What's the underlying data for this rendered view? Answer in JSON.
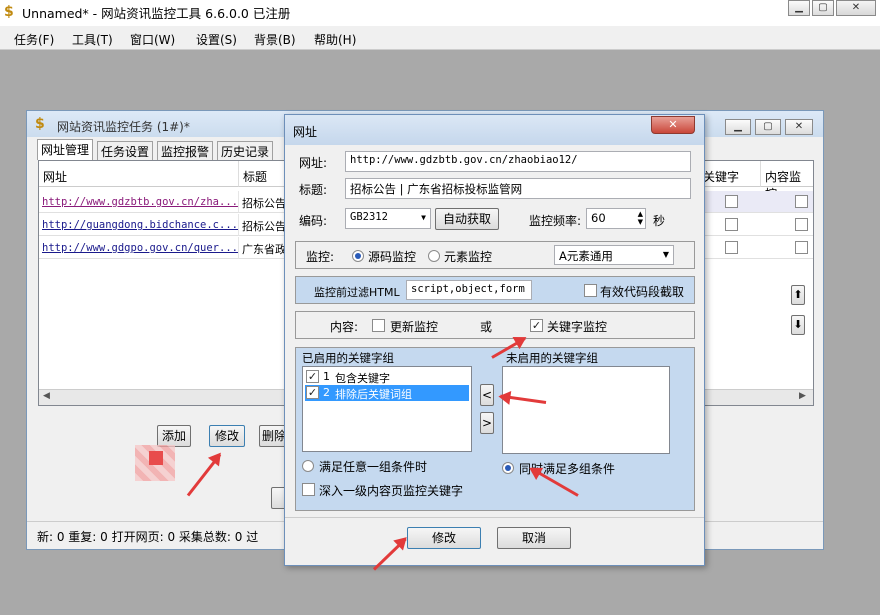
{
  "main_window": {
    "title": "Unnamed* - 网站资讯监控工具 6.6.0.0 已注册",
    "app_icon": "dollar-icon",
    "menus": [
      "任务(F)",
      "工具(T)",
      "窗口(W)",
      "设置(S)",
      "背景(B)",
      "帮助(H)"
    ]
  },
  "task_window": {
    "title": "网站资讯监控任务 (1#)*",
    "tabs": [
      "网址管理",
      "任务设置",
      "监控报警",
      "历史记录"
    ],
    "columns": {
      "url": "网址",
      "title": "标题",
      "keyword": "关键字",
      "content": "内容监控"
    },
    "rows": [
      {
        "url": "http://www.gdzbtb.gov.cn/zha...",
        "title": "招标公告"
      },
      {
        "url": "http://guangdong.bidchance.c...",
        "title": "招标公告"
      },
      {
        "url": "http://www.gdgpo.gov.cn/quer...",
        "title": "广东省政"
      }
    ],
    "buttons": {
      "add": "添加",
      "modify": "修改",
      "delete": "删除"
    },
    "status_bar": "新: 0  重复: 0  打开网页: 0  采集总数: 0  过"
  },
  "dialog": {
    "title": "网址",
    "url_label": "网址:",
    "url_value": "http://www.gdzbtb.gov.cn/zhaobiao12/",
    "title_label": "标题:",
    "title_value": "招标公告 | 广东省招标投标监管网",
    "encoding_label": "编码:",
    "encoding_value": "GB2312",
    "auto_get_button": "自动获取",
    "frequency_label": "监控频率:",
    "frequency_value": "60",
    "frequency_unit": "秒",
    "monitor_label": "监控:",
    "source_monitor": "源码监控",
    "element_monitor": "元素监控",
    "element_select": "A元素通用",
    "prefilter_label": "监控前过滤HTML",
    "prefilter_value": "script,object,form",
    "valid_code_label": "有效代码段截取",
    "content_label": "内容:",
    "update_monitor": "更新监控",
    "or_label": "或",
    "keyword_monitor": "关键字监控",
    "enabled_groups_label": "已启用的关键字组",
    "enabled_groups": [
      {
        "num": "1",
        "label": "包含关键字",
        "checked": true,
        "selected": false
      },
      {
        "num": "2",
        "label": "排除后关键词组",
        "checked": true,
        "selected": true
      }
    ],
    "disabled_groups_label": "未启用的关键字组",
    "move_left": "<",
    "move_right": ">",
    "any_group_label": "满足任意一组条件时",
    "all_groups_label": "同时满足多组条件",
    "deep_label": "深入一级内容页监控关键字",
    "modify_button": "修改",
    "cancel_button": "取消"
  },
  "colors": {
    "arrow": "#e23a3a",
    "selected_row": "#3399ff",
    "link": "#1a1a8c"
  }
}
